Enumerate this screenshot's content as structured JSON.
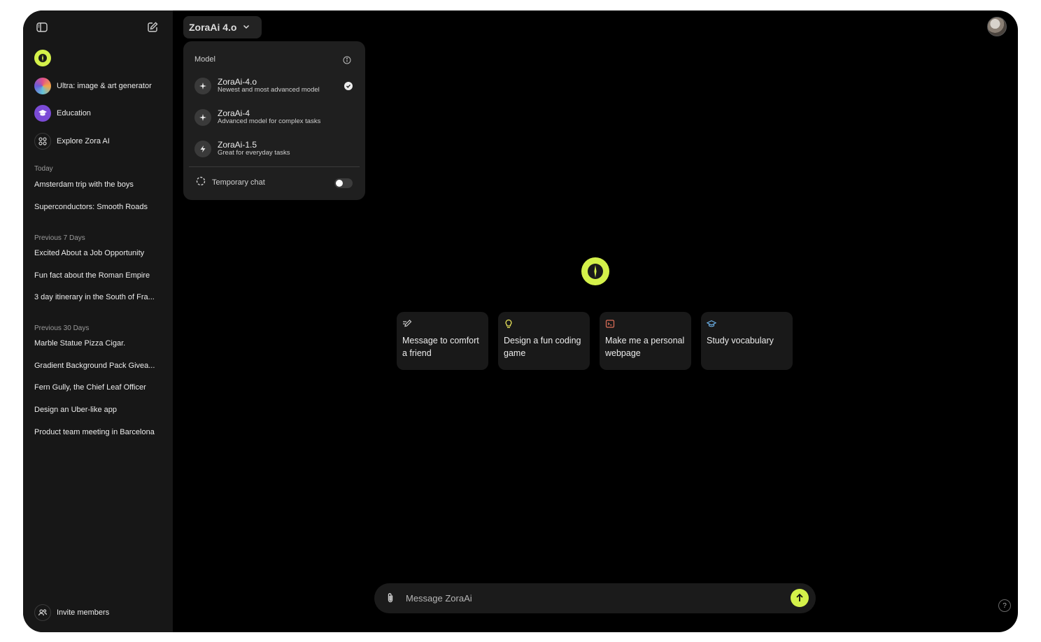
{
  "header": {
    "model_label": "ZoraAi 4.o"
  },
  "sidebar": {
    "pinned": [
      {
        "label": "Ultra: image & art generator"
      },
      {
        "label": "Education"
      },
      {
        "label": "Explore Zora AI"
      }
    ],
    "sections": [
      {
        "title": "Today",
        "chats": [
          "Amsterdam trip with the boys",
          "Superconductors: Smooth Roads"
        ]
      },
      {
        "title": "Previous 7 Days",
        "chats": [
          "Excited About a Job Opportunity",
          "Fun fact about the Roman Empire",
          "3 day itinerary in the South of Fra..."
        ]
      },
      {
        "title": "Previous 30 Days",
        "chats": [
          "Marble Statue Pizza Cigar.",
          "Gradient Background Pack Givea...",
          "Fern Gully, the Chief Leaf Officer",
          "Design an Uber-like app",
          "Product team meeting in Barcelona"
        ]
      }
    ],
    "invite_label": "Invite members"
  },
  "dropdown": {
    "header": "Model",
    "options": [
      {
        "name": "ZoraAi-4.o",
        "desc": "Newest and most advanced model",
        "selected": true
      },
      {
        "name": "ZoraAi-4",
        "desc": "Advanced model for complex tasks",
        "selected": false
      },
      {
        "name": "ZoraAi-1.5",
        "desc": "Great for everyday tasks",
        "selected": false
      }
    ],
    "temporary_chat_label": "Temporary chat",
    "temporary_chat_enabled": false
  },
  "suggestions": [
    {
      "text": "Message to comfort a friend",
      "icon": "pen-icon",
      "color": "#cfcfcf"
    },
    {
      "text": "Design a fun coding game",
      "icon": "lightbulb-icon",
      "color": "#e8e35a"
    },
    {
      "text": "Make me a personal webpage",
      "icon": "terminal-icon",
      "color": "#e0705a"
    },
    {
      "text": "Study vocabulary",
      "icon": "graduation-cap-icon",
      "color": "#6fb6ef"
    }
  ],
  "composer": {
    "placeholder": "Message ZoraAi"
  },
  "help_label": "?",
  "colors": {
    "accent": "#d4f14a",
    "sidebar_bg": "#171717",
    "main_bg": "#000000"
  }
}
